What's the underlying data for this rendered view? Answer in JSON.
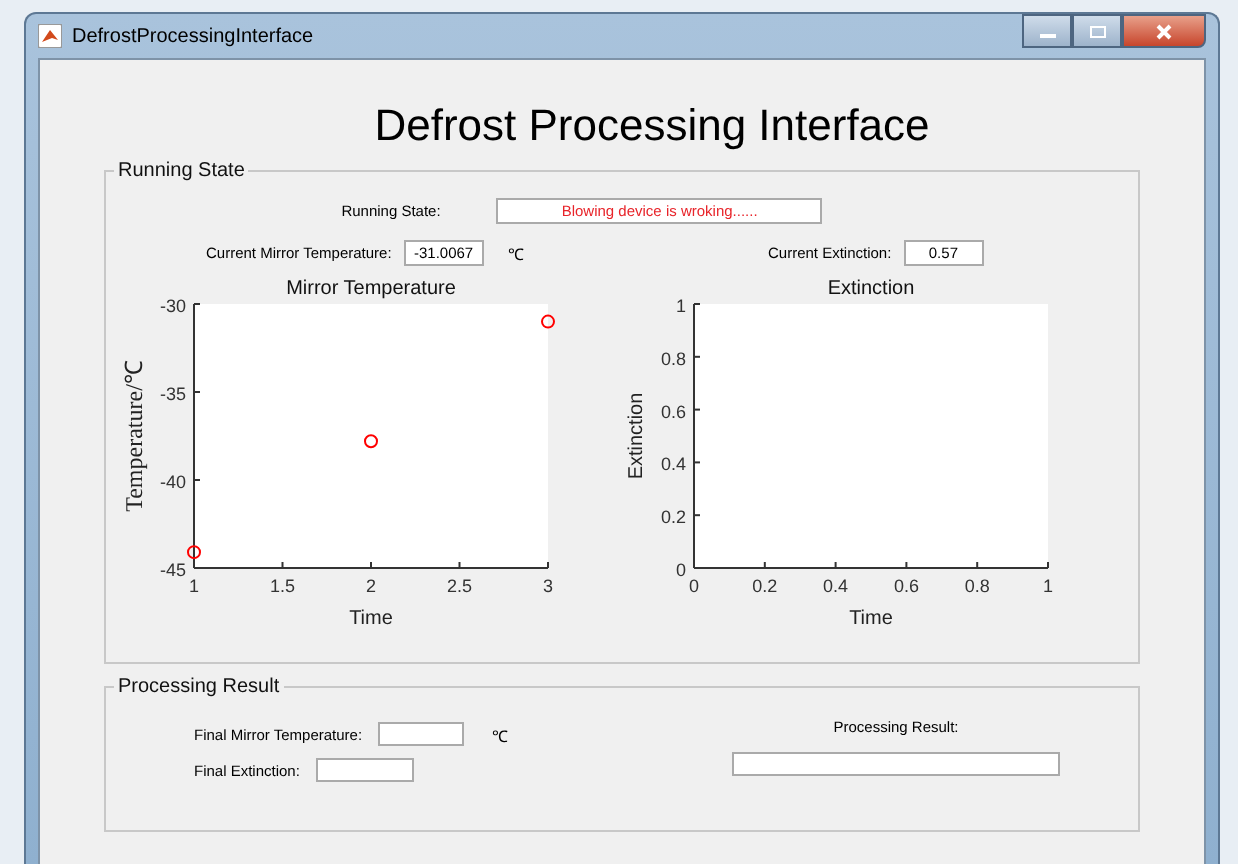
{
  "window": {
    "title": "DefrostProcessingInterface"
  },
  "heading": "Defrost Processing Interface",
  "running_state": {
    "legend": "Running State",
    "state_label": "Running State:",
    "state_value": "Blowing device is wroking......",
    "temp_label": "Current Mirror Temperature:",
    "temp_value": "-31.0067",
    "temp_unit": "℃",
    "ext_label": "Current Extinction:",
    "ext_value": "0.57",
    "charts": [
      {
        "chart_data": {
          "type": "scatter",
          "title": "Mirror Temperature",
          "xlabel": "Time",
          "ylabel": "Temperature/℃",
          "xlim": [
            1,
            3
          ],
          "ylim": [
            -45,
            -30
          ],
          "xticks": [
            1,
            1.5,
            2,
            2.5,
            3
          ],
          "yticks": [
            -45,
            -40,
            -35,
            -30
          ],
          "series": [
            {
              "color": "#ff0000",
              "x": [
                1,
                2,
                3
              ],
              "values": [
                -44.1,
                -37.8,
                -31.0
              ]
            }
          ]
        }
      },
      {
        "chart_data": {
          "type": "line",
          "title": "Extinction",
          "xlabel": "Time",
          "ylabel": "Extinction",
          "xlim": [
            0,
            1
          ],
          "ylim": [
            0,
            1
          ],
          "xticks": [
            0,
            0.2,
            0.4,
            0.6,
            0.8,
            1
          ],
          "yticks": [
            0,
            0.2,
            0.4,
            0.6,
            0.8,
            1
          ]
        }
      }
    ]
  },
  "processing_result": {
    "legend": "Processing Result",
    "final_temp_label": "Final Mirror Temperature:",
    "final_temp_unit": "℃",
    "final_ext_label": "Final Extinction:",
    "result_label": "Processing Result:"
  }
}
